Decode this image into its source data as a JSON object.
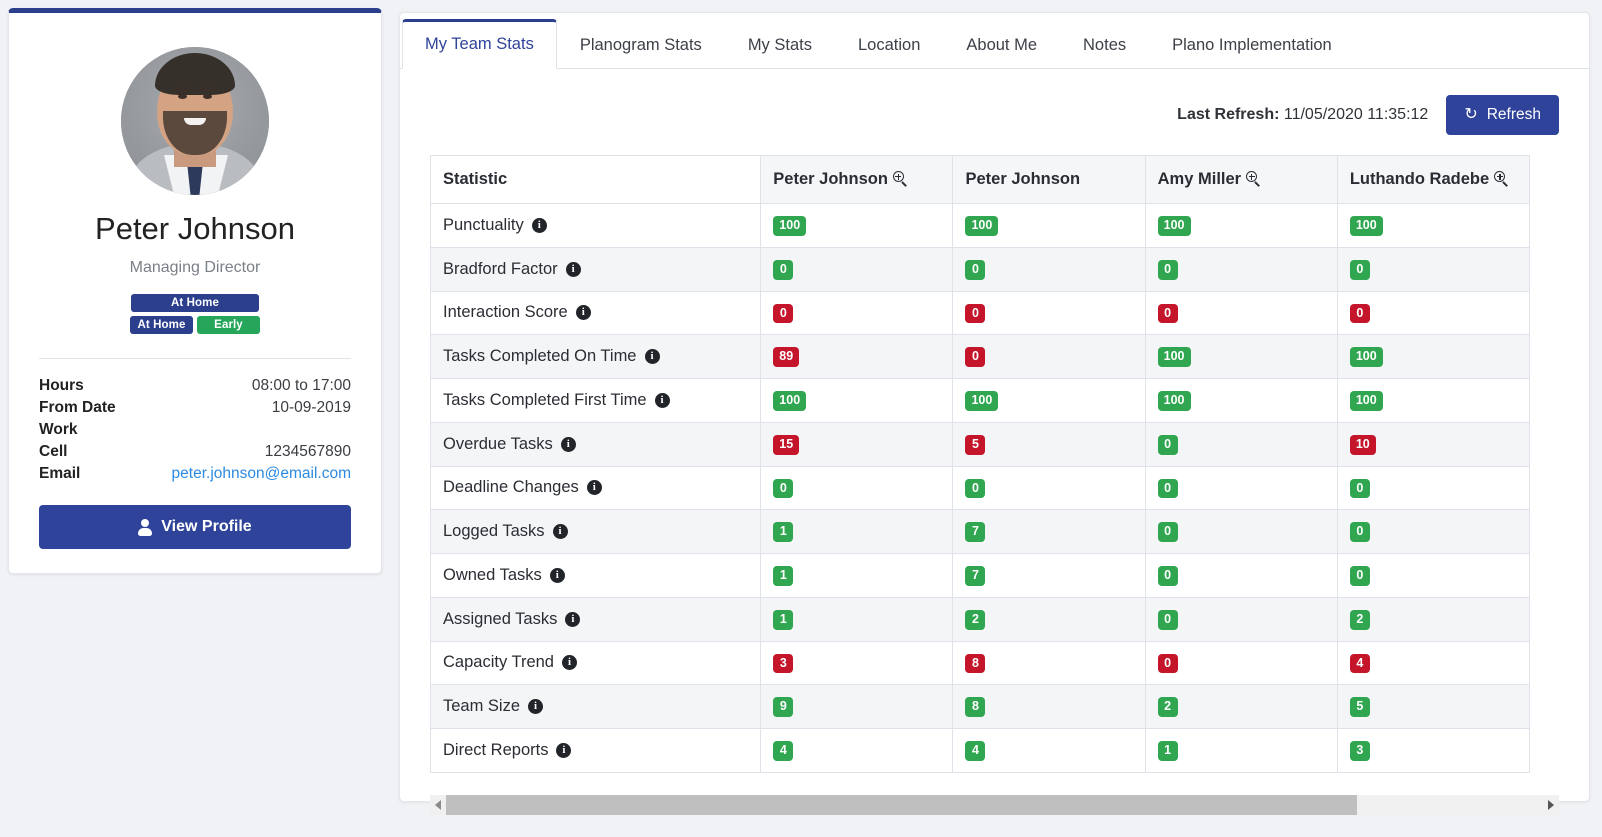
{
  "profile": {
    "avatar_alt": "Peter Johnson profile photo",
    "name": "Peter Johnson",
    "role": "Managing Director",
    "status_primary": "At Home",
    "status_secondary_left": "At Home",
    "status_secondary_right": "Early",
    "details": [
      {
        "label": "Hours",
        "value": "08:00 to 17:00",
        "is_link": false
      },
      {
        "label": "From Date",
        "value": "10-09-2019",
        "is_link": false
      },
      {
        "label": "Work",
        "value": "",
        "is_link": false
      },
      {
        "label": "Cell",
        "value": "1234567890",
        "is_link": false
      },
      {
        "label": "Email",
        "value": "peter.johnson@email.com",
        "is_link": true
      }
    ],
    "view_profile_label": "View Profile",
    "accent_color": "#2f439a",
    "status_green": "#26a65b"
  },
  "tabs": [
    {
      "label": "My Team Stats",
      "active": true
    },
    {
      "label": "Planogram Stats",
      "active": false
    },
    {
      "label": "My Stats",
      "active": false
    },
    {
      "label": "Location",
      "active": false
    },
    {
      "label": "About Me",
      "active": false
    },
    {
      "label": "Notes",
      "active": false
    },
    {
      "label": "Plano Implementation",
      "active": false
    }
  ],
  "toolbar": {
    "last_refresh_label": "Last Refresh:",
    "last_refresh_value": "11/05/2020 11:35:12",
    "refresh_label": "Refresh",
    "refresh_icon": "refresh-icon"
  },
  "table": {
    "columns": [
      {
        "label": "Statistic",
        "has_search_icon": false
      },
      {
        "label": "Peter Johnson",
        "has_search_icon": true
      },
      {
        "label": "Peter Johnson",
        "has_search_icon": false
      },
      {
        "label": "Amy Miller",
        "has_search_icon": true
      },
      {
        "label": "Luthando Radebe",
        "has_search_icon": true
      }
    ],
    "rows": [
      {
        "statistic": "Punctuality",
        "values": [
          {
            "text": "100",
            "color": "green"
          },
          {
            "text": "100",
            "color": "green"
          },
          {
            "text": "100",
            "color": "green"
          },
          {
            "text": "100",
            "color": "green"
          }
        ]
      },
      {
        "statistic": "Bradford Factor",
        "values": [
          {
            "text": "0",
            "color": "green"
          },
          {
            "text": "0",
            "color": "green"
          },
          {
            "text": "0",
            "color": "green"
          },
          {
            "text": "0",
            "color": "green"
          }
        ]
      },
      {
        "statistic": "Interaction Score",
        "values": [
          {
            "text": "0",
            "color": "red"
          },
          {
            "text": "0",
            "color": "red"
          },
          {
            "text": "0",
            "color": "red"
          },
          {
            "text": "0",
            "color": "red"
          }
        ]
      },
      {
        "statistic": "Tasks Completed On Time",
        "values": [
          {
            "text": "89",
            "color": "red"
          },
          {
            "text": "0",
            "color": "red"
          },
          {
            "text": "100",
            "color": "green"
          },
          {
            "text": "100",
            "color": "green"
          }
        ]
      },
      {
        "statistic": "Tasks Completed First Time",
        "values": [
          {
            "text": "100",
            "color": "green"
          },
          {
            "text": "100",
            "color": "green"
          },
          {
            "text": "100",
            "color": "green"
          },
          {
            "text": "100",
            "color": "green"
          }
        ]
      },
      {
        "statistic": "Overdue Tasks",
        "values": [
          {
            "text": "15",
            "color": "red"
          },
          {
            "text": "5",
            "color": "red"
          },
          {
            "text": "0",
            "color": "green"
          },
          {
            "text": "10",
            "color": "red"
          }
        ]
      },
      {
        "statistic": "Deadline Changes",
        "values": [
          {
            "text": "0",
            "color": "green"
          },
          {
            "text": "0",
            "color": "green"
          },
          {
            "text": "0",
            "color": "green"
          },
          {
            "text": "0",
            "color": "green"
          }
        ]
      },
      {
        "statistic": "Logged Tasks",
        "values": [
          {
            "text": "1",
            "color": "green"
          },
          {
            "text": "7",
            "color": "green"
          },
          {
            "text": "0",
            "color": "green"
          },
          {
            "text": "0",
            "color": "green"
          }
        ]
      },
      {
        "statistic": "Owned Tasks",
        "values": [
          {
            "text": "1",
            "color": "green"
          },
          {
            "text": "7",
            "color": "green"
          },
          {
            "text": "0",
            "color": "green"
          },
          {
            "text": "0",
            "color": "green"
          }
        ]
      },
      {
        "statistic": "Assigned Tasks",
        "values": [
          {
            "text": "1",
            "color": "green"
          },
          {
            "text": "2",
            "color": "green"
          },
          {
            "text": "0",
            "color": "green"
          },
          {
            "text": "2",
            "color": "green"
          }
        ]
      },
      {
        "statistic": "Capacity Trend",
        "values": [
          {
            "text": "3",
            "color": "red"
          },
          {
            "text": "8",
            "color": "red"
          },
          {
            "text": "0",
            "color": "red"
          },
          {
            "text": "4",
            "color": "red"
          }
        ]
      },
      {
        "statistic": "Team Size",
        "values": [
          {
            "text": "9",
            "color": "green"
          },
          {
            "text": "8",
            "color": "green"
          },
          {
            "text": "2",
            "color": "green"
          },
          {
            "text": "5",
            "color": "green"
          }
        ]
      },
      {
        "statistic": "Direct Reports",
        "values": [
          {
            "text": "4",
            "color": "green"
          },
          {
            "text": "4",
            "color": "green"
          },
          {
            "text": "1",
            "color": "green"
          },
          {
            "text": "3",
            "color": "green"
          }
        ]
      }
    ],
    "row_info_icon": "info-icon",
    "badge_green": "#2fa64f",
    "badge_red": "#c4152b"
  },
  "scrollbar": {
    "left_arrow_icon": "chevron-left-icon",
    "right_arrow_icon": "chevron-right-icon",
    "thumb_percent": 83
  }
}
